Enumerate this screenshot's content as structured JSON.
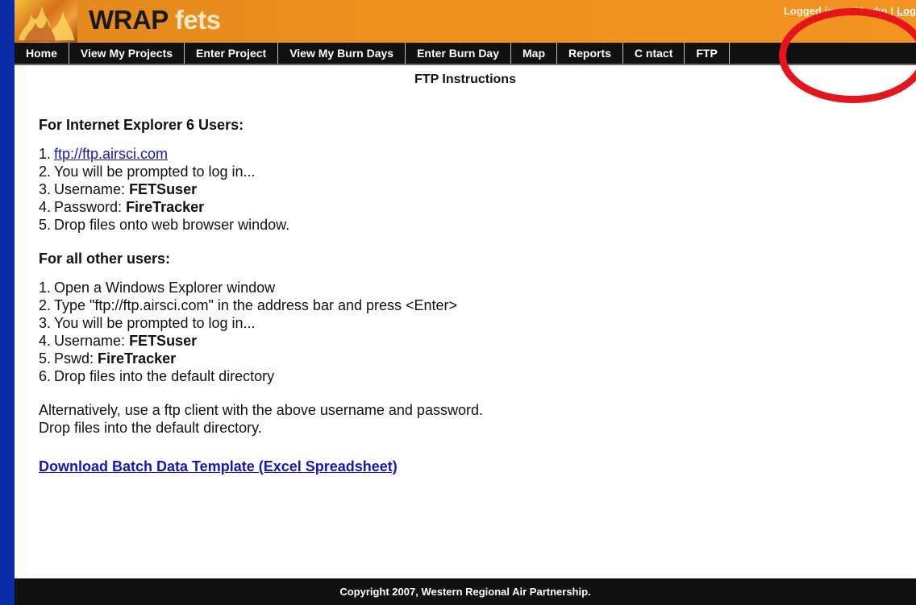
{
  "header": {
    "logo_wrap": "WRAP",
    "logo_fets": "fets",
    "login_prefix": "Logged in as: M",
    "login_user": "avko",
    "logout_label": "Log"
  },
  "nav": {
    "items": [
      {
        "label": "Home"
      },
      {
        "label": "View My Projects"
      },
      {
        "label": "Enter Project"
      },
      {
        "label": "View My Burn Days"
      },
      {
        "label": "Enter Burn Day"
      },
      {
        "label": "Map"
      },
      {
        "label": "Reports"
      },
      {
        "label": "C ntact"
      },
      {
        "label": "FTP"
      }
    ]
  },
  "page": {
    "title": "FTP Instructions"
  },
  "ie6": {
    "heading": "For Internet Explorer 6 Users:",
    "steps": [
      {
        "num": "1.",
        "link": "ftp://ftp.airsci.com"
      },
      {
        "num": "2.",
        "text": "You will be prompted to log in..."
      },
      {
        "num": "3.",
        "text": "Username: ",
        "bold": "FETSuser"
      },
      {
        "num": "4.",
        "text": "Password: ",
        "bold": "FireTracker"
      },
      {
        "num": "5.",
        "text": "Drop files onto web browser window."
      }
    ]
  },
  "others": {
    "heading": "For all other users:",
    "steps": [
      {
        "num": "1.",
        "text": "Open a Windows Explorer window"
      },
      {
        "num": "2.",
        "text": "Type \"ftp://ftp.airsci.com\" in the address bar and press <Enter>"
      },
      {
        "num": "3.",
        "text": "You will be prompted to log in..."
      },
      {
        "num": "4.",
        "text": "Username: ",
        "bold": "FETSuser"
      },
      {
        "num": "5.",
        "text": "Pswd: ",
        "bold": "FireTracker"
      },
      {
        "num": "6.",
        "text": "Drop files into the default directory"
      }
    ]
  },
  "alternative": {
    "line1": "Alternatively, use a ftp client with the above username and password.",
    "line2": "Drop files into the default directory."
  },
  "download": {
    "label": "Download Batch Data Template (Excel Spreadsheet)"
  },
  "footer": {
    "copyright": "Copyright 2007, Western Regional Air Partnership."
  },
  "colors": {
    "page_background": "#0a2aa8",
    "header_orange": "#ef8f1e",
    "nav_black": "#111111",
    "link_blue": "#1515c8",
    "annotation_red": "#e8141b"
  }
}
